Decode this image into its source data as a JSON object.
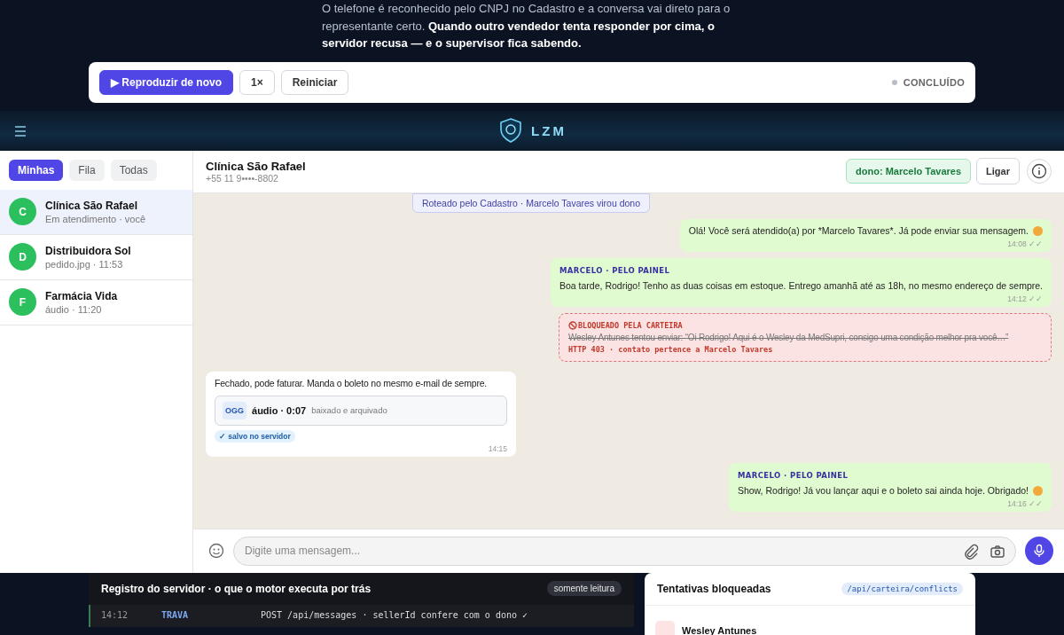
{
  "intro": {
    "text": "O telefone é reconhecido pelo CNPJ no Cadastro e a conversa vai direto para o representante certo. **Quando outro vendedor tenta responder por cima, o servidor recusa — e o supervisor fica sabendo.**"
  },
  "player": {
    "buttons": [
      {
        "label": "▶ Reproduzir de novo",
        "kind": "primary"
      },
      {
        "label": "1×",
        "kind": "plain"
      },
      {
        "label": "Reiniciar",
        "kind": "plain"
      }
    ],
    "status": "CONCLUÍDO"
  },
  "app": {
    "brand": "LZM"
  },
  "sidebar": {
    "tabs": [
      {
        "label": "Minhas",
        "selected": true
      },
      {
        "label": "Fila",
        "selected": false
      },
      {
        "label": "Todas",
        "selected": false
      }
    ],
    "conversations": [
      {
        "initial": "C",
        "name": "Clínica São Rafael",
        "subtitle": "Em atendimento · você",
        "selected": true
      },
      {
        "initial": "D",
        "name": "Distribuidora Sol",
        "subtitle": "pedido.jpg · 11:53",
        "selected": false
      },
      {
        "initial": "F",
        "name": "Farmácia Vida",
        "subtitle": "áudio · 11:20",
        "selected": false
      }
    ]
  },
  "chat": {
    "title": "Clínica São Rafael",
    "phone": "+55 11 9••••-8802",
    "owner": "dono: Marcelo Tavares",
    "call": "Ligar",
    "messages": [
      {
        "kind": "system",
        "text": "Roteado pelo Cadastro · Marcelo Tavares virou dono"
      },
      {
        "kind": "outgoing",
        "text": "Olá! Você será atendido(a) por *Marcelo Tavares*. Já pode enviar sua mensagem.",
        "emoji": true,
        "time": "14:08 ✓✓"
      },
      {
        "kind": "outgoing",
        "author": "MARCELO · PELO PAINEL",
        "text": "Boa tarde, Rodrigo! Tenho as duas coisas em estoque. Entrego amanhã até as 18h, no mesmo endereço de sempre.",
        "time": "14:12 ✓✓"
      },
      {
        "kind": "blocked",
        "author": "BLOQUEADO PELA CARTEIRA",
        "text": "Wesley Antunes tentou enviar: “Oi Rodrigo! Aqui é o Wesley da MedSupri, consigo uma condição melhor pra você…”",
        "error": "HTTP 403 · contato pertence a Marcelo Tavares"
      },
      {
        "kind": "incoming",
        "text": "Fechado, pode faturar. Manda o boleto no mesmo e-mail de sempre.",
        "attachment": {
          "type": "OGG",
          "title": "áudio · 0:07",
          "note": "baixado e arquivado"
        },
        "saved": "✓ salvo no servidor",
        "time": "14:15"
      },
      {
        "kind": "outgoing",
        "author": "MARCELO · PELO PAINEL",
        "text": "Show, Rodrigo! Já vou lançar aqui e o boleto sai ainda hoje. Obrigado!",
        "emoji": true,
        "time": "14:16 ✓✓"
      }
    ],
    "composer": {
      "placeholder": "Digite uma mensagem..."
    }
  },
  "log": {
    "title": "Registro do servidor · o que o motor executa por trás",
    "badge": "somente leitura",
    "rows": [
      {
        "time": "14:12",
        "tag": "TRAVA",
        "text": "POST /api/messages · sellerId confere com o dono ✓"
      }
    ]
  },
  "conflicts": {
    "title": "Tentativas bloqueadas",
    "endpoint": "/api/carteira/conflicts",
    "rows": [
      {
        "name": "Wesley Antunes"
      }
    ]
  }
}
